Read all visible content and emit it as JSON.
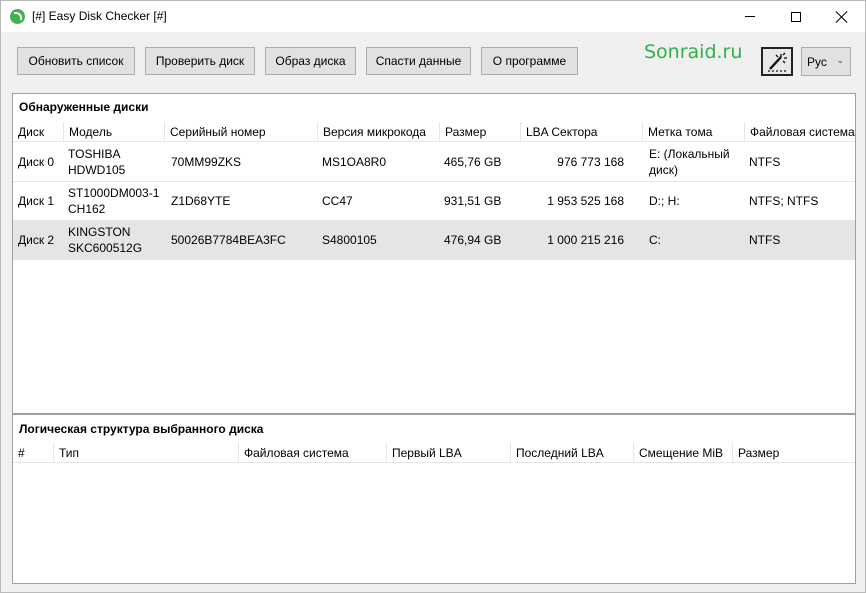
{
  "window": {
    "title": "[#] Easy Disk Checker [#]"
  },
  "toolbar": {
    "refresh_label": "Обновить список",
    "check_label": "Проверить диск",
    "image_label": "Образ диска",
    "rescue_label": "Спасти данные",
    "about_label": "О программе"
  },
  "brand": "Sonraid.ru",
  "language": {
    "selected": "Рус"
  },
  "disks_panel": {
    "title": "Обнаруженные диски",
    "columns": [
      "Диск",
      "Модель",
      "Серийный номер",
      "Версия микрокода",
      "Размер",
      "LBA Сектора",
      "Метка тома",
      "Файловая система"
    ],
    "rows": [
      {
        "disk": "Диск 0",
        "model": "TOSHIBA HDWD105",
        "serial": "70MM99ZKS",
        "firmware": "MS1OA8R0",
        "size": "465,76 GB",
        "lba": "976 773 168",
        "label": "E: (Локальный диск)",
        "fs": "NTFS"
      },
      {
        "disk": "Диск 1",
        "model": "ST1000DM003-1 CH162",
        "serial": "Z1D68YTE",
        "firmware": "CC47",
        "size": "931,51 GB",
        "lba": "1 953 525 168",
        "label": "D:; H:",
        "fs": "NTFS; NTFS"
      },
      {
        "disk": "Диск 2",
        "model": "KINGSTON SKC600512G",
        "serial": "50026B7784BEA3FC",
        "firmware": "S4800105",
        "size": "476,94 GB",
        "lba": "1 000 215 216",
        "label": "C:",
        "fs": "NTFS"
      }
    ]
  },
  "structure_panel": {
    "title": "Логическая структура выбранного диска",
    "columns": [
      "#",
      "Тип",
      "Файловая система",
      "Первый LBA",
      "Последний LBA",
      "Смещение MiB",
      "Размер"
    ]
  },
  "icons": {
    "app": "app-disk-icon",
    "tool": "wand-tool-icon"
  },
  "colors": {
    "brand": "#2db34a",
    "selected_row": "#e5e5e5"
  }
}
